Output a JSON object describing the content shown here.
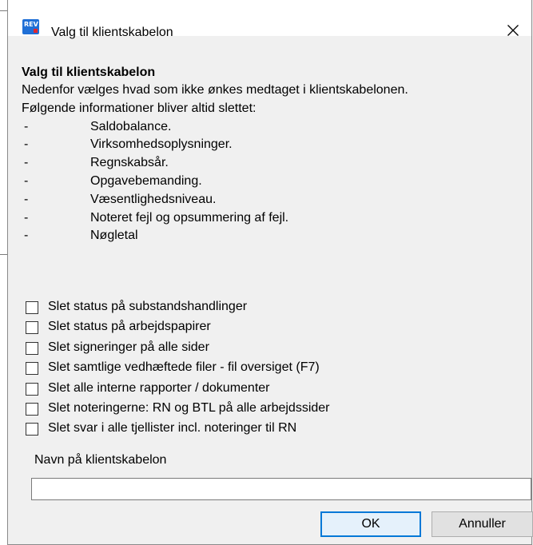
{
  "window": {
    "title": "Valg til klientskabelon",
    "logo_text": "REV",
    "close_icon": "close-icon"
  },
  "content": {
    "heading": "Valg til klientskabelon",
    "intro": "Nedenfor vælges hvad som ikke ønkes medtaget i klientskabelonen.",
    "always_deleted": "Følgende informationer bliver altid slettet:",
    "bullets": [
      {
        "dash": "-",
        "text": "Saldobalance."
      },
      {
        "dash": "-",
        "text": "Virksomhedsoplysninger."
      },
      {
        "dash": "-",
        "text": "Regnskabsår."
      },
      {
        "dash": "-",
        "text": "Opgavebemanding."
      },
      {
        "dash": "-",
        "text": "Væsentlighedsniveau."
      },
      {
        "dash": "-",
        "text": "Noteret fejl og opsummering af fejl."
      },
      {
        "dash": "-",
        "text": "Nøgletal"
      }
    ]
  },
  "options": [
    {
      "label": "Slet status på substandshandlinger",
      "checked": false
    },
    {
      "label": "Slet status på arbejdspapirer",
      "checked": false
    },
    {
      "label": "Slet signeringer på alle sider",
      "checked": false
    },
    {
      "label": "Slet samtlige vedhæftede filer - fil oversiget (F7)",
      "checked": false
    },
    {
      "label": "Slet alle interne rapporter / dokumenter",
      "checked": false
    },
    {
      "label": "Slet noteringerne: RN og BTL på alle arbejdssider",
      "checked": false
    },
    {
      "label": "Slet svar i alle tjellister incl. noteringer til RN",
      "checked": false
    }
  ],
  "name_field": {
    "label": "Navn på klientskabelon",
    "value": ""
  },
  "buttons": {
    "ok": "OK",
    "cancel": "Annuller"
  }
}
